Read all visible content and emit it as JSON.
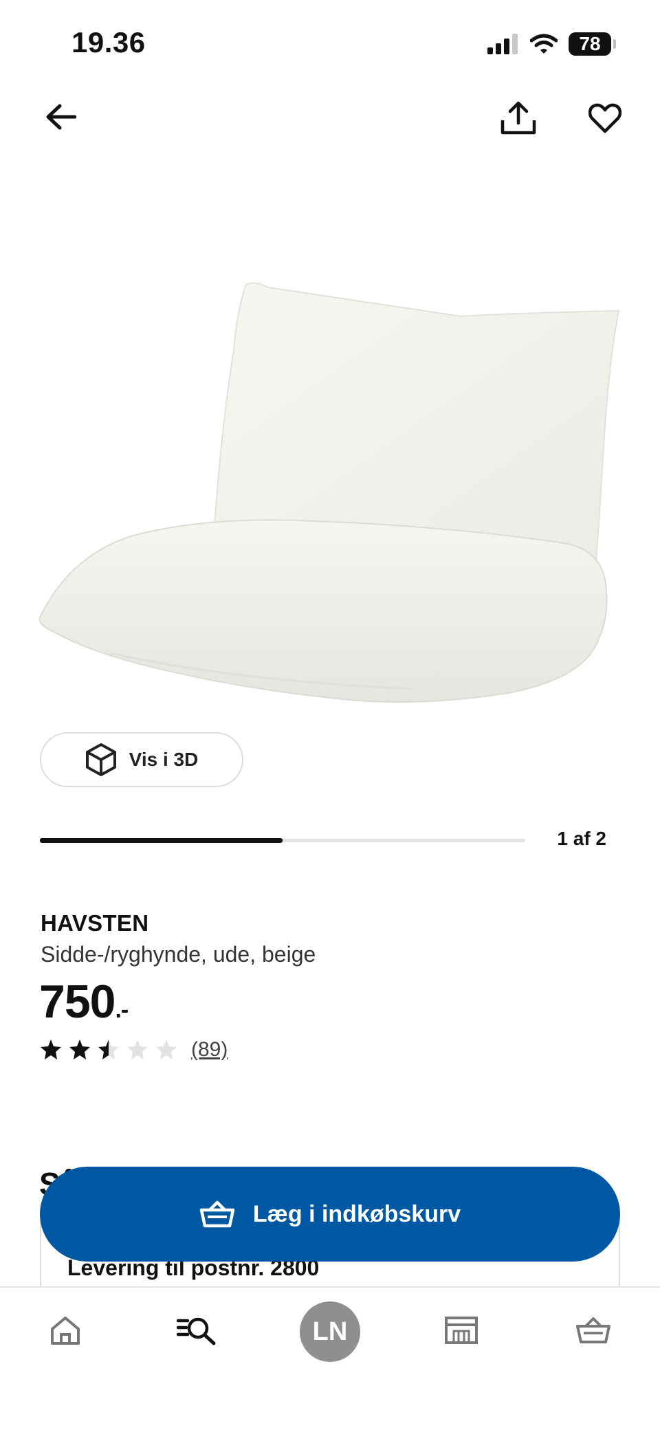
{
  "status_bar": {
    "time": "19.36",
    "battery": "78"
  },
  "product": {
    "brand": "HAVSTEN",
    "description": "Sidde-/ryghynde, ude, beige",
    "price": "750",
    "price_suffix": ".-",
    "rating": 2.5,
    "rating_max": 5,
    "review_count": "(89)"
  },
  "gallery": {
    "view_3d_label": "Vis i 3D",
    "position_label": "1 af 2",
    "progress": 0.5
  },
  "section_peek_text": "Så",
  "delivery_card_text": "Levering til postnr. 2800",
  "add_to_cart_label": "Læg i indkøbskurv",
  "bottom_nav": {
    "avatar_initials": "LN"
  },
  "colors": {
    "accent_blue": "#0058a3",
    "text": "#111111",
    "avatar_gray": "#8f8f8f"
  }
}
